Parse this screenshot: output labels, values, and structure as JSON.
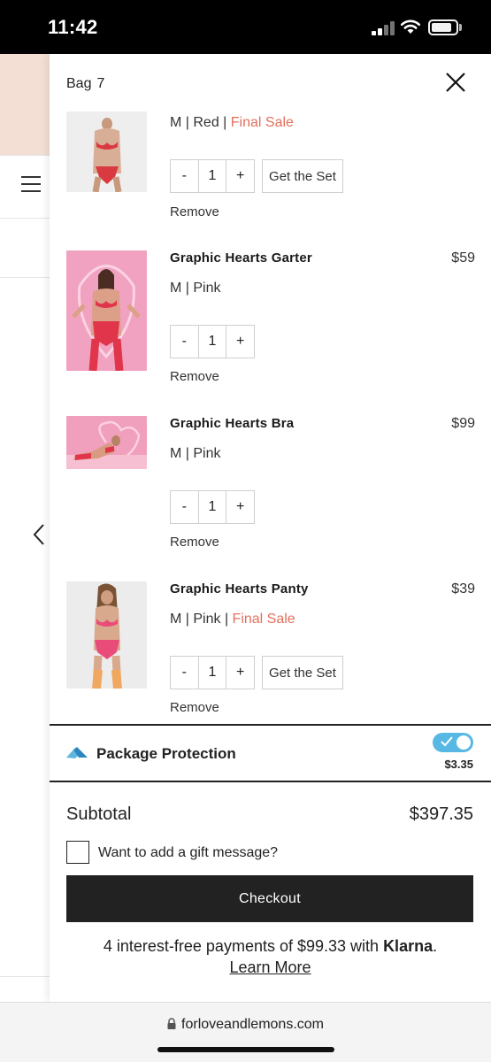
{
  "status_bar": {
    "time": "11:42"
  },
  "bag": {
    "title": "Bag",
    "count": "7"
  },
  "items": [
    {
      "name": "",
      "price": "",
      "size": "M",
      "color": "Red",
      "final_sale": "Final Sale",
      "quantity": "1",
      "get_set": "Get the Set",
      "remove": "Remove"
    },
    {
      "name": "Graphic Hearts Garter",
      "price": "$59",
      "size": "M",
      "color": "Pink",
      "quantity": "1",
      "remove": "Remove"
    },
    {
      "name": "Graphic Hearts Bra",
      "price": "$99",
      "size": "M",
      "color": "Pink",
      "quantity": "1",
      "remove": "Remove"
    },
    {
      "name": "Graphic Hearts Panty",
      "price": "$39",
      "size": "M",
      "color": "Pink",
      "final_sale": "Final Sale",
      "quantity": "1",
      "get_set": "Get the Set",
      "remove": "Remove"
    }
  ],
  "qty_controls": {
    "minus": "-",
    "plus": "+"
  },
  "separator": " | ",
  "package_protection": {
    "label": "Package Protection",
    "price": "$3.35",
    "enabled": true
  },
  "summary": {
    "subtotal_label": "Subtotal",
    "subtotal_value": "$397.35",
    "gift_message": "Want to add a gift message?",
    "checkout": "Checkout",
    "klarna_text": "4 interest-free payments of $99.33 with",
    "klarna_brand": "Klarna",
    "klarna_period": ".",
    "learn_more": "Learn More"
  },
  "browser": {
    "url": "forloveandlemons.com"
  },
  "colors": {
    "final_sale": "#e4705c",
    "toggle": "#58b8e4",
    "checkout_bg": "#222222"
  }
}
